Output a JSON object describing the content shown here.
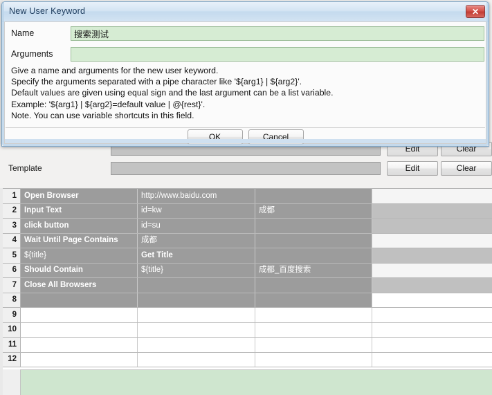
{
  "dialog": {
    "title": "New User Keyword",
    "close_icon": "close-icon",
    "close_glyph": "✕",
    "name_label": "Name",
    "name_value": "搜索测试",
    "name_placeholder": "",
    "arguments_label": "Arguments",
    "arguments_value": "",
    "arguments_placeholder": "",
    "help_text": "Give a name and arguments for the new user keyword.\nSpecify the arguments separated with a pipe character like '${arg1} | ${arg2}'.\nDefault values are given using equal sign and the last argument can be a list variable.\nExample: '${arg1} | ${arg2}=default value | @{rest}'.\nNote. You can use variable shortcuts in this field.",
    "ok_label": "OK",
    "cancel_label": "Cancel"
  },
  "settings": {
    "hidden_row": {
      "label": "",
      "value": "",
      "edit_label": "Edit",
      "clear_label": "Clear"
    },
    "template_row": {
      "label": "Template",
      "value": "",
      "edit_label": "Edit",
      "clear_label": "Clear"
    }
  },
  "grid": {
    "rows": [
      {
        "num": "1",
        "shade": "sh-dark",
        "cells": [
          {
            "text": "Open Browser",
            "bold": true,
            "shade": "sh-dark"
          },
          {
            "text": "http://www.baidu.com",
            "bold": false,
            "shade": "sh-dark"
          },
          {
            "text": "",
            "bold": false,
            "shade": "sh-dark"
          },
          {
            "text": "",
            "bold": false,
            "shade": "sh-light"
          }
        ]
      },
      {
        "num": "2",
        "shade": "sh-dark",
        "cells": [
          {
            "text": "Input Text",
            "bold": true,
            "shade": "sh-dark"
          },
          {
            "text": "id=kw",
            "bold": false,
            "shade": "sh-dark"
          },
          {
            "text": "成都",
            "bold": false,
            "shade": "sh-dark"
          },
          {
            "text": "",
            "bold": false,
            "shade": "sh-mid"
          }
        ]
      },
      {
        "num": "3",
        "shade": "sh-dark",
        "cells": [
          {
            "text": "click button",
            "bold": true,
            "shade": "sh-dark"
          },
          {
            "text": "id=su",
            "bold": false,
            "shade": "sh-dark"
          },
          {
            "text": "",
            "bold": false,
            "shade": "sh-dark"
          },
          {
            "text": "",
            "bold": false,
            "shade": "sh-mid"
          }
        ]
      },
      {
        "num": "4",
        "shade": "sh-dark",
        "cells": [
          {
            "text": "Wait Until Page Contains",
            "bold": true,
            "shade": "sh-dark"
          },
          {
            "text": "成都",
            "bold": false,
            "shade": "sh-dark"
          },
          {
            "text": "",
            "bold": false,
            "shade": "sh-dark"
          },
          {
            "text": "",
            "bold": false,
            "shade": "sh-light"
          }
        ]
      },
      {
        "num": "5",
        "shade": "sh-dark",
        "cells": [
          {
            "text": "${title}",
            "bold": false,
            "shade": "sh-dark"
          },
          {
            "text": "Get Title",
            "bold": true,
            "shade": "sh-dark"
          },
          {
            "text": "",
            "bold": false,
            "shade": "sh-dark"
          },
          {
            "text": "",
            "bold": false,
            "shade": "sh-mid"
          }
        ]
      },
      {
        "num": "6",
        "shade": "sh-dark",
        "cells": [
          {
            "text": "Should Contain",
            "bold": true,
            "shade": "sh-dark"
          },
          {
            "text": "${title}",
            "bold": false,
            "shade": "sh-dark"
          },
          {
            "text": "成都_百度搜索",
            "bold": false,
            "shade": "sh-dark"
          },
          {
            "text": "",
            "bold": false,
            "shade": "sh-light"
          }
        ]
      },
      {
        "num": "7",
        "shade": "sh-dark",
        "cells": [
          {
            "text": "Close All Browsers",
            "bold": true,
            "shade": "sh-dark"
          },
          {
            "text": "",
            "bold": false,
            "shade": "sh-dark"
          },
          {
            "text": "",
            "bold": false,
            "shade": "sh-dark"
          },
          {
            "text": "",
            "bold": false,
            "shade": "sh-mid"
          }
        ]
      },
      {
        "num": "8",
        "shade": "sh-dark",
        "cells": [
          {
            "text": "",
            "bold": false,
            "shade": "sh-dark"
          },
          {
            "text": "",
            "bold": false,
            "shade": "sh-dark"
          },
          {
            "text": "",
            "bold": false,
            "shade": "sh-dark"
          },
          {
            "text": "",
            "bold": false,
            "shade": "sh-none"
          }
        ]
      },
      {
        "num": "9",
        "shade": "sh-none",
        "cells": [
          {
            "text": "",
            "bold": false,
            "shade": "sh-none"
          },
          {
            "text": "",
            "bold": false,
            "shade": "sh-none"
          },
          {
            "text": "",
            "bold": false,
            "shade": "sh-none"
          },
          {
            "text": "",
            "bold": false,
            "shade": "sh-none"
          }
        ]
      },
      {
        "num": "10",
        "shade": "sh-none",
        "cells": [
          {
            "text": "",
            "bold": false,
            "shade": "sh-none"
          },
          {
            "text": "",
            "bold": false,
            "shade": "sh-none"
          },
          {
            "text": "",
            "bold": false,
            "shade": "sh-none"
          },
          {
            "text": "",
            "bold": false,
            "shade": "sh-none"
          }
        ]
      },
      {
        "num": "11",
        "shade": "sh-none",
        "cells": [
          {
            "text": "",
            "bold": false,
            "shade": "sh-none"
          },
          {
            "text": "",
            "bold": false,
            "shade": "sh-none"
          },
          {
            "text": "",
            "bold": false,
            "shade": "sh-none"
          },
          {
            "text": "",
            "bold": false,
            "shade": "sh-none"
          }
        ]
      },
      {
        "num": "12",
        "shade": "sh-none",
        "cells": [
          {
            "text": "",
            "bold": false,
            "shade": "sh-none"
          },
          {
            "text": "",
            "bold": false,
            "shade": "sh-none"
          },
          {
            "text": "",
            "bold": false,
            "shade": "sh-none"
          },
          {
            "text": "",
            "bold": false,
            "shade": "sh-none"
          }
        ]
      }
    ]
  },
  "colors": {
    "dialog_border": "#7ea6c8",
    "titlebar": "#c4daee",
    "close_button": "#c23c34",
    "field_green": "#d6ecd3",
    "grid_selected": "#9c9c9c",
    "footer_green": "#cfe6cf"
  }
}
